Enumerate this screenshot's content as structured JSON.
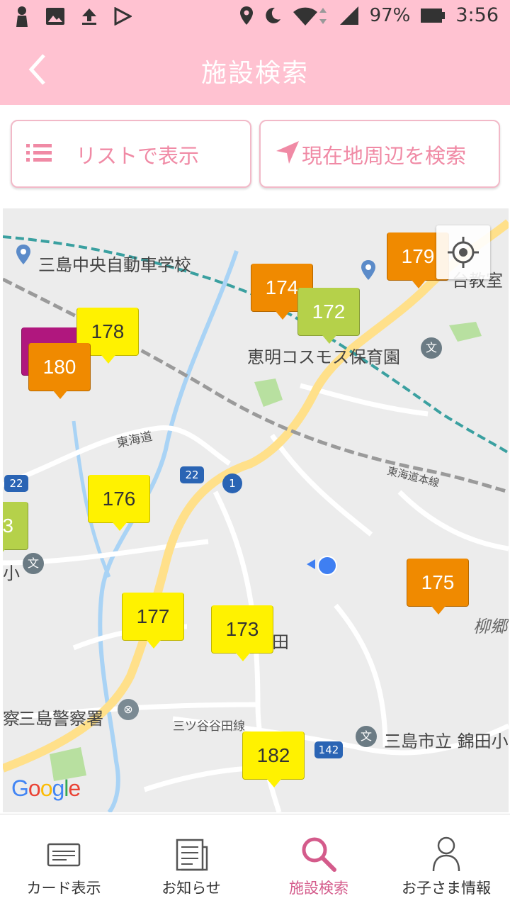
{
  "status_bar": {
    "battery": "97%",
    "time": "3:56",
    "icons": [
      "notification-icon",
      "image-icon",
      "upload-icon",
      "play-store-icon",
      "location-icon",
      "moon-icon",
      "wifi-icon",
      "signal-icon",
      "battery-icon"
    ]
  },
  "app_bar": {
    "title": "施設検索",
    "back_icon": "chevron-left-icon"
  },
  "buttons": {
    "list_label": "リストで表示",
    "near_label": "現在地周辺を検索"
  },
  "map": {
    "markers": [
      {
        "label": "179",
        "color": "orange"
      },
      {
        "label": "174",
        "color": "orange"
      },
      {
        "label": "172",
        "color": "green"
      },
      {
        "label": "178",
        "color": "yellow"
      },
      {
        "label": "180",
        "color": "orange"
      },
      {
        "label": "176",
        "color": "yellow"
      },
      {
        "label": "3",
        "color": "green"
      },
      {
        "label": "175",
        "color": "orange"
      },
      {
        "label": "177",
        "color": "yellow"
      },
      {
        "label": "173",
        "color": "yellow"
      },
      {
        "label": "182",
        "color": "yellow"
      }
    ],
    "place_labels": {
      "driving_school": "三島中央自動車学校",
      "school_top_right": "台教室",
      "nursery": "恵明コスモス保育園",
      "tokaido": "東海道",
      "tokaido_line": "東海道本線",
      "police": "三島警察署",
      "police_prefix": "察",
      "mitsuyada_line": "三ツ谷谷田線",
      "school_bottom": "三島市立 錦田小",
      "yanagigo": "柳郷",
      "ta": "田",
      "sho": "小"
    },
    "route_shields": [
      "22",
      "22",
      "1",
      "142"
    ],
    "attribution": "Google",
    "colors": {
      "orange": "#f08a00",
      "yellow": "#fff200",
      "green": "#b5d14a",
      "purple": "#b0177e"
    }
  },
  "tabs": [
    {
      "label": "カード表示",
      "icon": "card-icon",
      "active": false
    },
    {
      "label": "お知らせ",
      "icon": "news-icon",
      "active": false
    },
    {
      "label": "施設検索",
      "icon": "search-icon",
      "active": true
    },
    {
      "label": "お子さま情報",
      "icon": "person-icon",
      "active": false
    }
  ],
  "accent_color": "#ffc2d1"
}
